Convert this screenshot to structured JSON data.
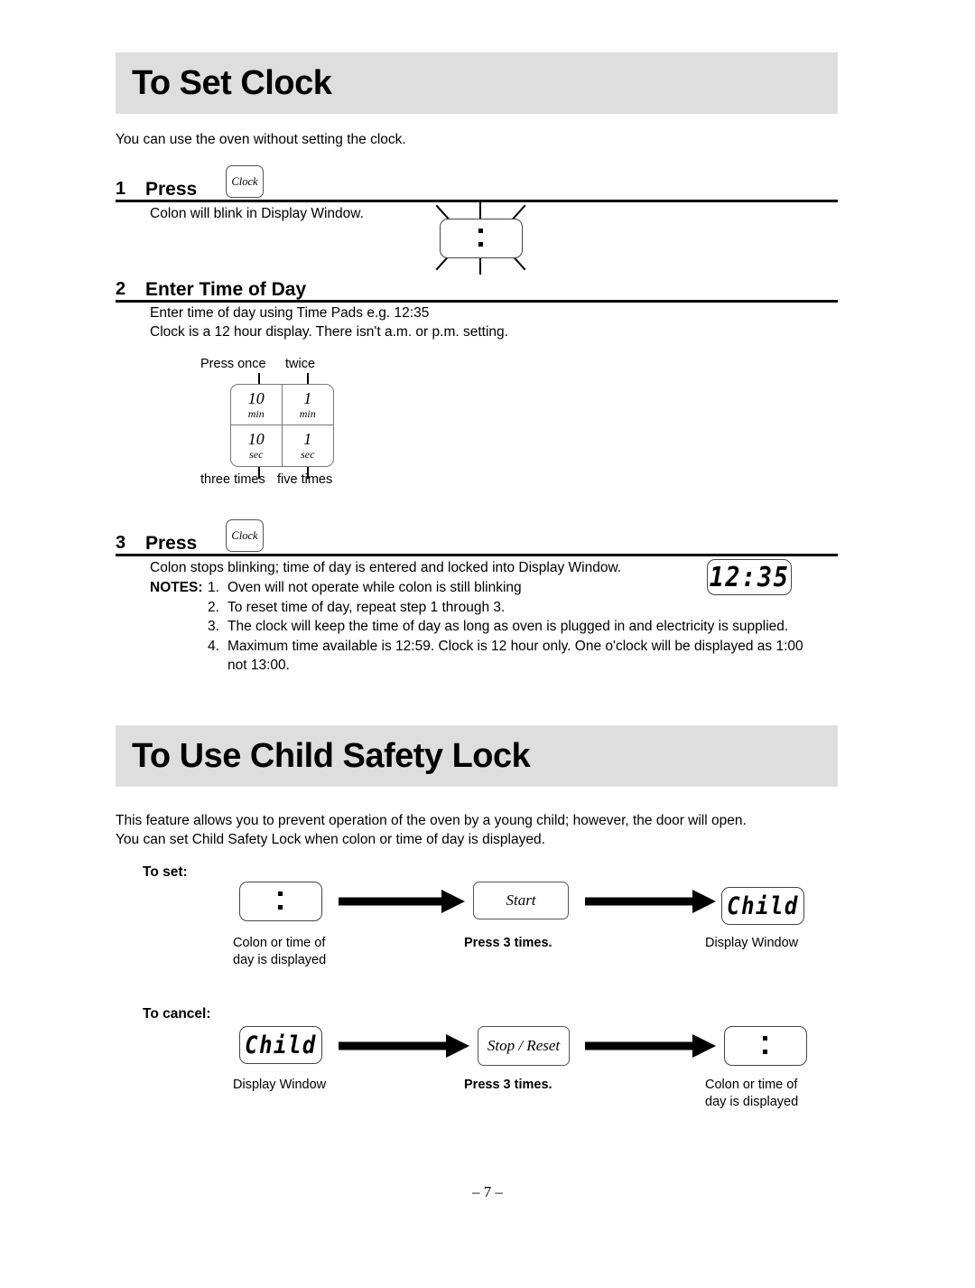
{
  "page": {
    "footer": "– 7 –"
  },
  "sections": [
    {
      "title": "To Set Clock",
      "intro": "You can use the oven without setting the clock.",
      "steps": [
        {
          "number": "1",
          "label": "Press",
          "key": "Clock",
          "body": "Colon will blink in Display Window.",
          "display": ":"
        },
        {
          "number": "2",
          "label": "Enter Time of Day",
          "body": "Enter time of day using Time Pads e.g. 12:35\nClock is a 12 hour display. There isn't a.m. or p.m. setting."
        },
        {
          "number": "3",
          "label": "Press",
          "key": "Clock",
          "body": "Colon stops blinking; time of day is entered and locked into Display Window.",
          "display": "12:35"
        }
      ],
      "timepads": {
        "top_left_caption": "Press once",
        "top_right_caption": "twice",
        "bottom_left_caption": "three times",
        "bottom_right_caption": "five times",
        "pads": [
          {
            "value": "10",
            "unit": "min"
          },
          {
            "value": "1",
            "unit": "min"
          },
          {
            "value": "10",
            "unit": "sec"
          },
          {
            "value": "1",
            "unit": "sec"
          }
        ]
      },
      "notes": {
        "lead": "NOTES:",
        "items": [
          "1.",
          "2.",
          "3.",
          "4."
        ],
        "texts": [
          "Oven will not operate while colon is still blinking",
          "To reset time of day, repeat step 1 through 3.",
          "The clock will keep the time of day as long as oven is plugged in and electricity is supplied.",
          "Maximum time available is 12:59. Clock is 12 hour only. One o'clock will be displayed as 1:00\nnot 13:00."
        ]
      }
    },
    {
      "title": "To Use Child Safety Lock",
      "intro": "This feature allows you to prevent operation of the oven by a young child; however, the door will open.\nYou can set Child Safety Lock when colon or time of day is displayed.",
      "flows": [
        {
          "heading": "To set:",
          "start_display": ":",
          "start_caption": "Colon or time of\nday is displayed",
          "key": "Start",
          "key_caption": "Press 3 times.",
          "end_display": "Child",
          "end_caption": "Display Window"
        },
        {
          "heading": "To cancel:",
          "start_display": "Child",
          "start_caption": "Display Window",
          "key": "Stop / Reset",
          "key_caption": "Press 3 times.",
          "end_display": ":",
          "end_caption": "Colon or time of\nday is displayed"
        }
      ]
    }
  ],
  "colors": {
    "banner_bg": "#dedede",
    "rule": "#000000",
    "key_border": "#555555"
  }
}
